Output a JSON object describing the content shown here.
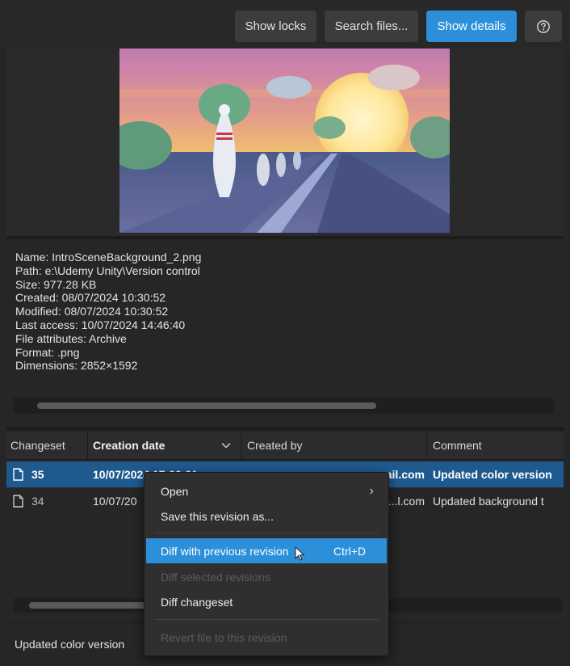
{
  "toolbar": {
    "show_locks": "Show locks",
    "search_files": "Search files...",
    "show_details": "Show details",
    "help_icon": "help-icon",
    "accent": "#2b90d9"
  },
  "preview": {
    "alt": "image preview"
  },
  "details": {
    "lines": [
      "Name: IntroSceneBackground_2.png",
      "Path: e:\\Udemy Unity\\Version control",
      "Size: 977.28 KB",
      "Created: 08/07/2024 10:30:52",
      "Modified: 08/07/2024 10:30:52",
      "Last access: 10/07/2024 14:46:40",
      "File attributes: Archive",
      "Format: .png",
      "Dimensions: 2852×1592"
    ]
  },
  "table": {
    "columns": [
      "Changeset",
      "Creation date",
      "Created by",
      "Comment"
    ],
    "rows": [
      {
        "changeset": "35",
        "date": "10/07/2024 17:00:01",
        "created_by": "...mail.com",
        "comment": "Updated color version",
        "selected": true
      },
      {
        "changeset": "34",
        "date": "10/07/20",
        "created_by": "...l.com",
        "comment": "Updated background t",
        "selected": false
      }
    ]
  },
  "context_menu": {
    "items": [
      {
        "label": "Open",
        "enabled": true,
        "submenu": true
      },
      {
        "label": "Save this revision as...",
        "enabled": true
      },
      {
        "label": "Diff with previous revision",
        "shortcut": "Ctrl+D",
        "enabled": true,
        "highlighted": true
      },
      {
        "label": "Diff selected revisions",
        "enabled": false
      },
      {
        "label": "Diff changeset",
        "enabled": true
      },
      {
        "label": "Revert file to this revision",
        "enabled": false
      }
    ]
  },
  "footer": {
    "comment": "Updated color version"
  }
}
